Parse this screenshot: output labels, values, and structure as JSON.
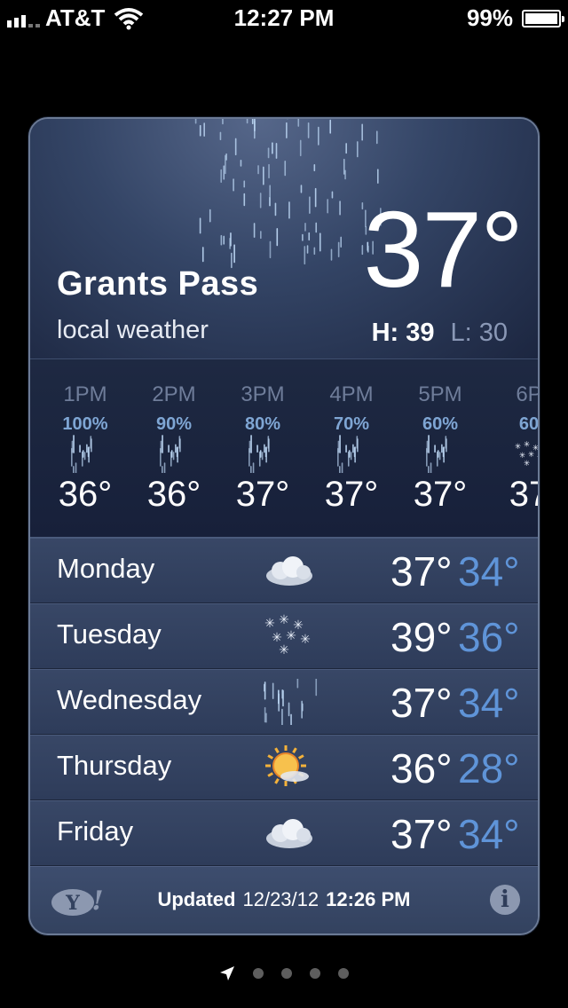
{
  "status_bar": {
    "carrier": "AT&T",
    "time": "12:27 PM",
    "battery_percent": "99%",
    "battery_level": 0.99,
    "signal_icon": "signal-bars-icon",
    "wifi_icon": "wifi-icon"
  },
  "weather": {
    "city": "Grants Pass",
    "subtitle": "local weather",
    "current_temp": "37°",
    "high": "H: 39",
    "low": "L: 30",
    "current_icon": "rain-icon",
    "hourly": [
      {
        "time": "1PM",
        "chance": "100%",
        "temp": "36°",
        "icon": "rain-icon"
      },
      {
        "time": "2PM",
        "chance": "90%",
        "temp": "36°",
        "icon": "rain-icon"
      },
      {
        "time": "3PM",
        "chance": "80%",
        "temp": "37°",
        "icon": "rain-icon"
      },
      {
        "time": "4PM",
        "chance": "70%",
        "temp": "37°",
        "icon": "rain-icon"
      },
      {
        "time": "5PM",
        "chance": "60%",
        "temp": "37°",
        "icon": "rain-icon"
      },
      {
        "time": "6P",
        "chance": "60",
        "temp": "37",
        "icon": "snow-icon"
      }
    ],
    "daily": [
      {
        "day": "Monday",
        "high": "37°",
        "low": "34°",
        "icon": "cloudy-icon"
      },
      {
        "day": "Tuesday",
        "high": "39°",
        "low": "36°",
        "icon": "snow-icon"
      },
      {
        "day": "Wednesday",
        "high": "37°",
        "low": "34°",
        "icon": "rain-icon"
      },
      {
        "day": "Thursday",
        "high": "36°",
        "low": "28°",
        "icon": "partly-sunny-icon"
      },
      {
        "day": "Friday",
        "high": "37°",
        "low": "34°",
        "icon": "cloudy-icon"
      }
    ],
    "footer": {
      "updated_label": "Updated",
      "updated_date": "12/23/12",
      "updated_time": "12:26 PM",
      "logo_text": "Y!",
      "info_label": "i"
    }
  },
  "pager": {
    "icons": [
      "location-arrow-icon",
      "page-dot",
      "page-dot",
      "page-dot",
      "page-dot"
    ]
  },
  "colors": {
    "accent_low_temp": "#5f94d8",
    "card_background": "#2e3d5c",
    "chance_text": "#7fa6d4"
  }
}
